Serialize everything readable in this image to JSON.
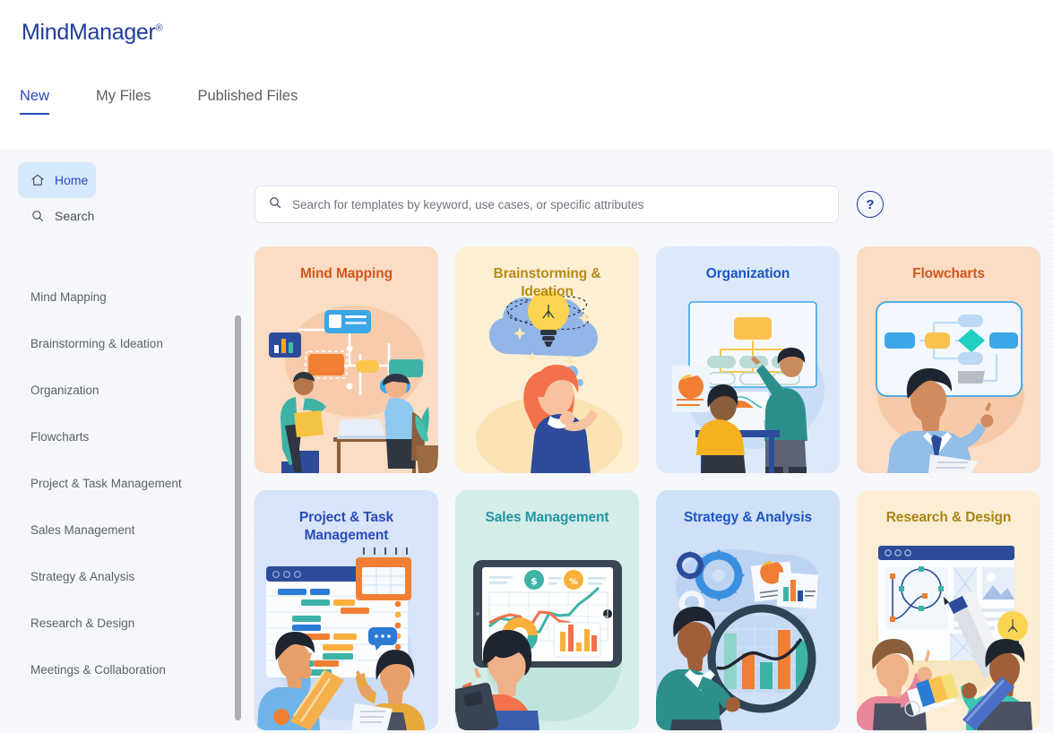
{
  "app": {
    "brand": "MindManager",
    "brand_mark": "®"
  },
  "tabs": [
    {
      "label": "New",
      "active": true
    },
    {
      "label": "My Files",
      "active": false
    },
    {
      "label": "Published Files",
      "active": false
    }
  ],
  "sidebar": {
    "nav": [
      {
        "label": "Home",
        "icon": "home-icon",
        "active": true
      },
      {
        "label": "Search",
        "icon": "search-icon",
        "active": false
      }
    ],
    "categories": [
      {
        "label": "Mind Mapping"
      },
      {
        "label": "Brainstorming & Ideation"
      },
      {
        "label": "Organization"
      },
      {
        "label": "Flowcharts"
      },
      {
        "label": "Project & Task Management"
      },
      {
        "label": "Sales Management"
      },
      {
        "label": "Strategy & Analysis"
      },
      {
        "label": "Research & Design"
      },
      {
        "label": "Meetings & Collaboration"
      }
    ]
  },
  "search": {
    "value": "",
    "placeholder": "Search for templates by keyword, use cases, or specific attributes",
    "icon": "search-icon"
  },
  "help": {
    "label": "?"
  },
  "cards": [
    {
      "title": "Mind Mapping",
      "bg": "#FBDCC4",
      "title_color": "#D0571C",
      "art": "mindmap"
    },
    {
      "title": "Brainstorming & Ideation",
      "bg": "#FDEFD4",
      "title_color": "#B68A15",
      "art": "bulb"
    },
    {
      "title": "Organization",
      "bg": "#DCE9FB",
      "title_color": "#1B56C4",
      "art": "orgchart"
    },
    {
      "title": "Flowcharts",
      "bg": "#FBDCC4",
      "title_color": "#D0571C",
      "art": "flowchart"
    },
    {
      "title": "Project & Task Management",
      "bg": "#D7E4FA",
      "title_color": "#2A4BB8",
      "art": "gantt"
    },
    {
      "title": "Sales Management",
      "bg": "#D4EDE8",
      "title_color": "#2196A4",
      "art": "tablet"
    },
    {
      "title": "Strategy & Analysis",
      "bg": "#CFE0F7",
      "title_color": "#1B56C4",
      "art": "magnifier"
    },
    {
      "title": "Research & Design",
      "bg": "#FBEED4",
      "title_color": "#A98418",
      "art": "design"
    }
  ],
  "colors": {
    "brand": "#1f3d9b",
    "accent": "#2a4bb8",
    "page_bg": "#f6f7fb",
    "header_bg": "#ffffff",
    "scrollbar": "#adaeb0"
  }
}
